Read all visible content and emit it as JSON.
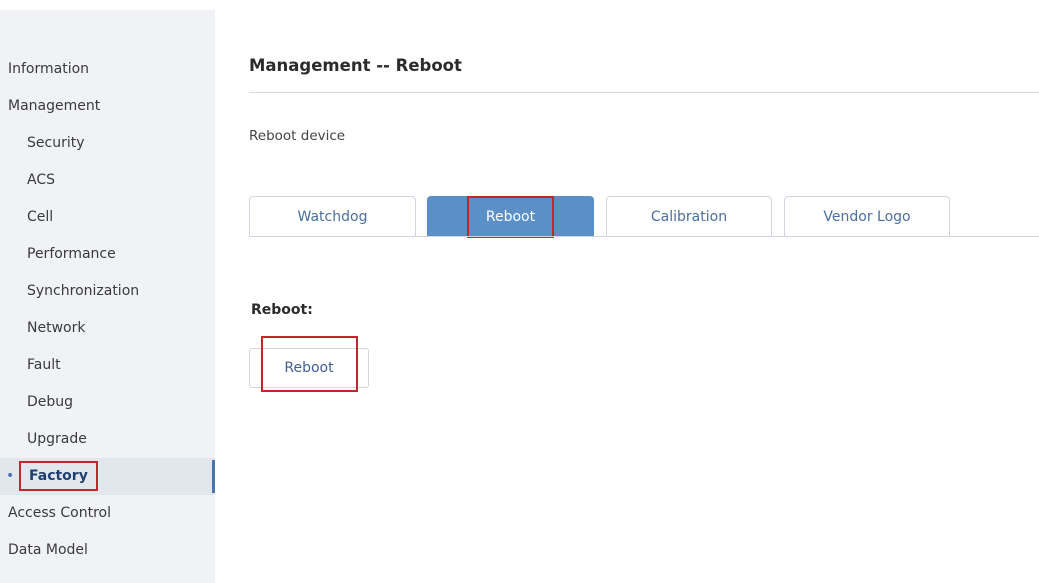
{
  "sidebar": {
    "items": [
      {
        "label": "Information",
        "level": 0
      },
      {
        "label": "Management",
        "level": 0
      },
      {
        "label": "Security",
        "level": 1
      },
      {
        "label": "ACS",
        "level": 1
      },
      {
        "label": "Cell",
        "level": 1
      },
      {
        "label": "Performance",
        "level": 1
      },
      {
        "label": "Synchronization",
        "level": 1
      },
      {
        "label": "Network",
        "level": 1
      },
      {
        "label": "Fault",
        "level": 1
      },
      {
        "label": "Debug",
        "level": 1
      },
      {
        "label": "Upgrade",
        "level": 1
      },
      {
        "label": "Factory",
        "level": 1,
        "active": true
      },
      {
        "label": "Access Control",
        "level": 0
      },
      {
        "label": "Data Model",
        "level": 0
      }
    ],
    "active_bullet": "•"
  },
  "main": {
    "title": "Management -- Reboot",
    "description": "Reboot device",
    "tabs": [
      {
        "label": "Watchdog"
      },
      {
        "label": "Reboot",
        "active": true
      },
      {
        "label": "Calibration"
      },
      {
        "label": "Vendor Logo"
      }
    ],
    "section_label": "Reboot:",
    "reboot_button_label": "Reboot"
  },
  "colors": {
    "accent": "#5b8fc7",
    "highlight": "#c0272d",
    "sidebar_bg": "#f0f2f5"
  }
}
